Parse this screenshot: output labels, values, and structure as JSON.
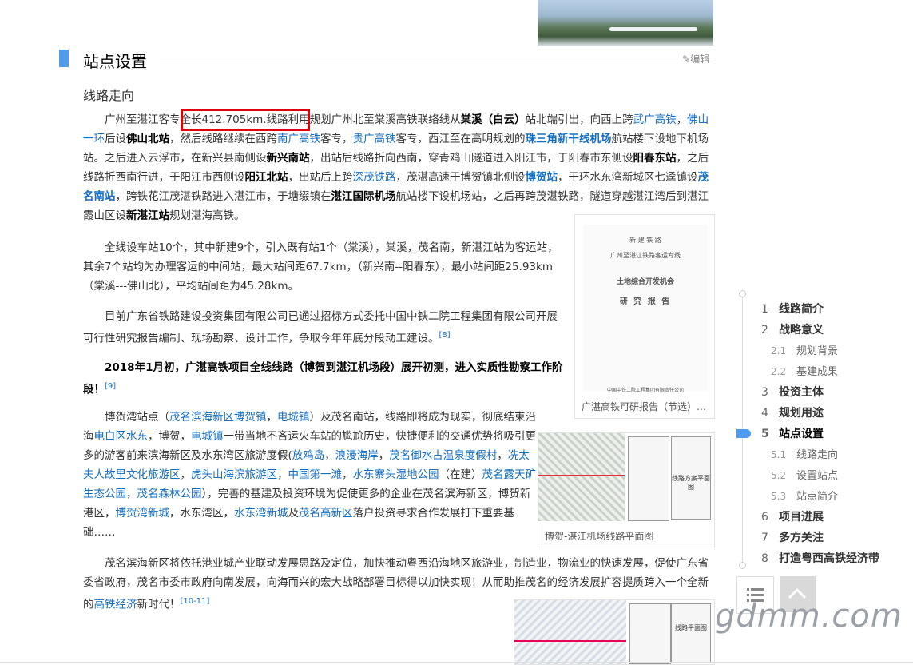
{
  "section": {
    "title": "站点设置",
    "edit_label": "编辑",
    "subtitle": "线路走向"
  },
  "paragraphs": {
    "p1": [
      {
        "t": "广州至湛江客专全长412.705km.线路利用规划广州北至棠溪高铁联络线从"
      },
      {
        "t": "棠溪（白云）",
        "b": 1
      },
      {
        "t": "站北端引出，向西上跨"
      },
      {
        "t": "武广高铁",
        "a": 1
      },
      {
        "t": "，"
      },
      {
        "t": "佛山一环",
        "a": 1
      },
      {
        "t": "后设"
      },
      {
        "t": "佛山北站",
        "b": 1
      },
      {
        "t": "，然后线路继续在西跨"
      },
      {
        "t": "南广高铁",
        "a": 1
      },
      {
        "t": "客专，"
      },
      {
        "t": "贵广高铁",
        "a": 1
      },
      {
        "t": "客专，西江至在高明规划的"
      },
      {
        "t": "珠三角新干线机场",
        "b": 1,
        "a": 1
      },
      {
        "t": "航站楼下设地下机场站。之后进入云浮市，在新兴县南侧设"
      },
      {
        "t": "新兴南站",
        "b": 1
      },
      {
        "t": "，出站后线路折向西南，穿青鸡山隧道进入阳江市，于阳春市东侧设"
      },
      {
        "t": "阳春东站",
        "b": 1
      },
      {
        "t": "，之后线路折西南行进，于阳江市西侧设"
      },
      {
        "t": "阳江北站",
        "b": 1
      },
      {
        "t": "，出站后上跨"
      },
      {
        "t": "深茂铁路",
        "a": 1
      },
      {
        "t": "，茂湛高速于博贺镇北侧设"
      },
      {
        "t": "博贺站",
        "b": 1,
        "a": 1
      },
      {
        "t": "，于环水东湾新城区七迳镇设"
      },
      {
        "t": "茂名南站",
        "b": 1,
        "a": 1
      },
      {
        "t": "，跨铁花江茂湛铁路进入湛江市，于塘缀镇在"
      },
      {
        "t": "湛江国际机场",
        "b": 1
      },
      {
        "t": "航站楼下设机场站，之后再跨茂湛铁路，隧道穿越湛江湾后到湛江霞山区设"
      },
      {
        "t": "新湛江站",
        "b": 1
      },
      {
        "t": "规划湛海高铁。"
      }
    ],
    "p2": "全线设车站10个，其中新建9个，引入既有站1个（棠溪），棠溪，茂名南，新湛江站为客运站，其余7个站均为办理客运的中间站，最大站间距67.7km，（新兴南--阳春东），最小站间距25.93km（棠溪---佛山北），平均站间距为45.28km。",
    "p3": "目前广东省铁路建设投资集团有限公司已通过招标方式委托中国中铁二院工程集团有限公司开展可行性研究报告编制、现场勘察、设计工作，争取今年年底分段动工建设。",
    "p3_ref": "[8]",
    "p4": "2018年1月初，广湛高铁项目全线线路（博贺到湛江机场段）展开初测，进入实质性勘察工作阶段！",
    "p4_ref": "[9]",
    "p5": [
      {
        "t": "博贺湾站点（"
      },
      {
        "t": "茂名滨海新区博贺镇",
        "a": 1
      },
      {
        "t": "，"
      },
      {
        "t": "电城镇",
        "a": 1
      },
      {
        "t": "）及茂名南站，线路即将成为现实，彻底结束沿海"
      },
      {
        "t": "电白区水东",
        "a": 1
      },
      {
        "t": "，博贺，"
      },
      {
        "t": "电城镇",
        "a": 1
      },
      {
        "t": "一带当地不吝运火车站的尴尬历史，快捷便利的交通优势将吸引更多的游客前来滨海新区及水东湾区旅游度假("
      },
      {
        "t": "放鸡岛",
        "a": 1
      },
      {
        "t": "，"
      },
      {
        "t": "浪漫海岸",
        "a": 1
      },
      {
        "t": "，"
      },
      {
        "t": "茂名御水古温泉度假村",
        "a": 1
      },
      {
        "t": "，"
      },
      {
        "t": "冼太夫人故里文化旅游区",
        "a": 1
      },
      {
        "t": "，"
      },
      {
        "t": "虎头山海滨旅游区",
        "a": 1
      },
      {
        "t": "，"
      },
      {
        "t": "中国第一滩",
        "a": 1
      },
      {
        "t": "，"
      },
      {
        "t": "水东寨头湿地公园",
        "a": 1
      },
      {
        "t": "（在建）"
      },
      {
        "t": "茂名露天矿生态公园",
        "a": 1
      },
      {
        "t": "，"
      },
      {
        "t": "茂名森林公园",
        "a": 1
      },
      {
        "t": "），完善的基建及投资环境为促使更多的企业在茂名滨海新区，博贺新港区，"
      },
      {
        "t": "博贺湾新城",
        "a": 1
      },
      {
        "t": "，水东湾区，"
      },
      {
        "t": "水东湾新城",
        "a": 1
      },
      {
        "t": "及"
      },
      {
        "t": "茂名高新区",
        "a": 1
      },
      {
        "t": "落户投资寻求合作发展打下重要基础……"
      }
    ],
    "p6": [
      {
        "t": "茂名滨海新区将依托港业城产业联动发展思路及定位，加快推动粤西沿海地区旅游业，制造业，物流业的快速发展，促使广东省委省政府，茂名市委市政府向南发展，向海而兴的宏大战略部署目标得以加快实现！从而助推茂名的经济发展扩容提质跨入一个全新的"
      },
      {
        "t": "高铁经济",
        "a": 1
      },
      {
        "t": "新时代！"
      }
    ],
    "p6_ref": "[10-11]"
  },
  "figures": {
    "doc_caption": "广湛高铁可研报告（节选）…",
    "doc_lines": [
      "新 建 铁 路",
      "广州至湛江铁路客运专线",
      "土地综合开发机会",
      "研 究 报 告",
      "中国中铁二院工程集团有限责任公司"
    ],
    "map_caption": "博贺-湛江机场线路平面图",
    "map_sheet_title": "线路方案平面图",
    "map2_sheet_title": "线路平面图"
  },
  "toc": {
    "items": [
      {
        "num": "1",
        "label": "线路简介",
        "level": 1
      },
      {
        "num": "2",
        "label": "战略意义",
        "level": 1
      },
      {
        "num": "2.1",
        "label": "规划背景",
        "level": 2
      },
      {
        "num": "2.2",
        "label": "基建成果",
        "level": 2
      },
      {
        "num": "3",
        "label": "投资主体",
        "level": 1
      },
      {
        "num": "4",
        "label": "规划用途",
        "level": 1
      },
      {
        "num": "5",
        "label": "站点设置",
        "level": 1,
        "active": true
      },
      {
        "num": "5.1",
        "label": "线路走向",
        "level": 2
      },
      {
        "num": "5.2",
        "label": "设置站点",
        "level": 2
      },
      {
        "num": "5.3",
        "label": "站点简介",
        "level": 2
      },
      {
        "num": "6",
        "label": "项目进展",
        "level": 1
      },
      {
        "num": "7",
        "label": "多方关注",
        "level": 1
      },
      {
        "num": "8",
        "label": "打造粤西高铁经济带",
        "level": 1
      }
    ]
  },
  "watermark": "gdmm.com",
  "icons": {
    "edit": "pencil-icon",
    "list": "list-icon",
    "top": "back-to-top-icon"
  },
  "colors": {
    "accent": "#4f9cee",
    "link": "#136ec2",
    "highlight_box": "#e0000a"
  }
}
